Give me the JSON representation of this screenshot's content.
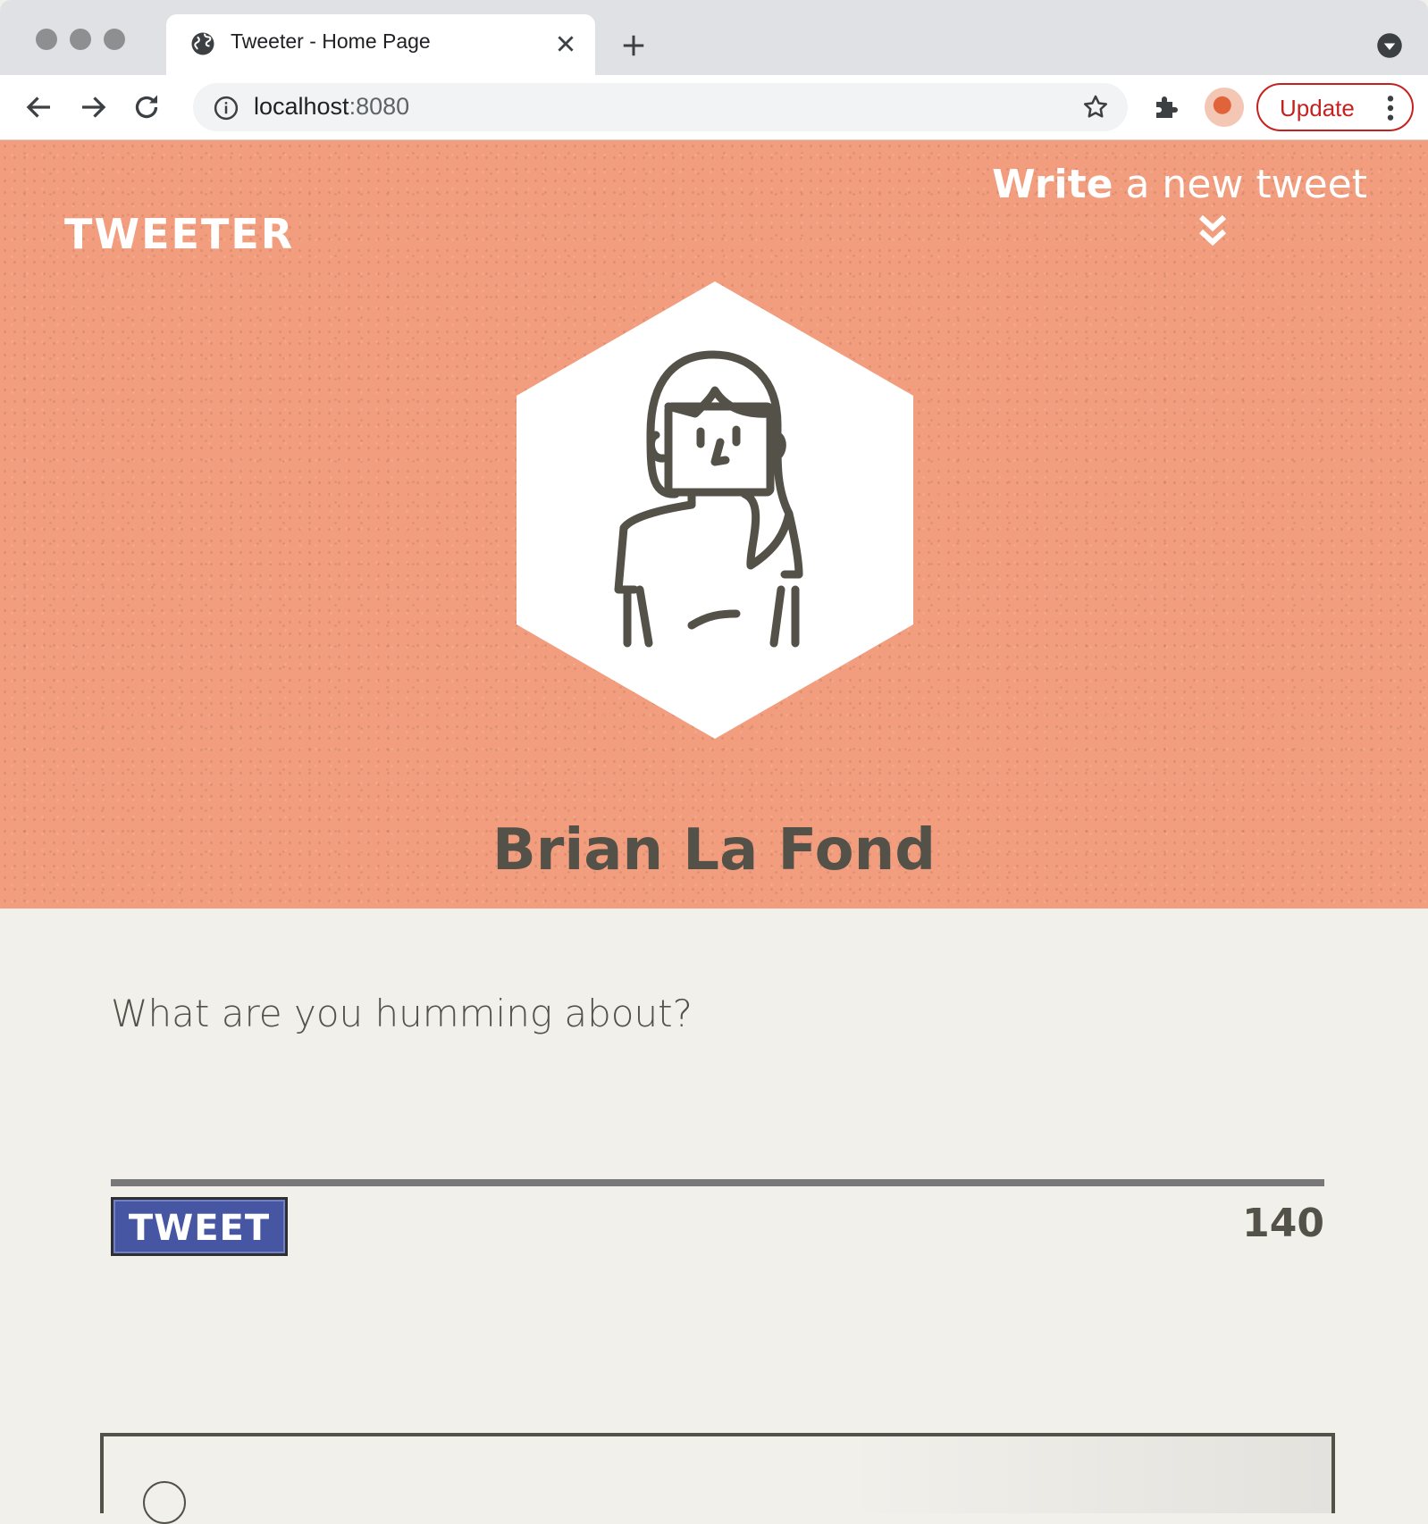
{
  "browser": {
    "tab_title": "Tweeter - Home Page",
    "url_host": "localhost",
    "url_port": ":8080",
    "update_label": "Update",
    "icons": [
      "globe-icon",
      "close-icon",
      "plus-icon",
      "tab-menu-icon",
      "back-icon",
      "forward-icon",
      "reload-icon",
      "info-icon",
      "star-icon",
      "puzzle-icon",
      "more-vert-icon"
    ]
  },
  "header": {
    "logo": "TWEETER",
    "write_strong": "Write",
    "write_rest": " a new tweet",
    "user_name": "Brian La Fond",
    "background_color": "#f19d7e"
  },
  "composer": {
    "placeholder": "What are you humming about?",
    "button_label": "TWEET",
    "char_count": "140",
    "button_color": "#4656a3"
  }
}
